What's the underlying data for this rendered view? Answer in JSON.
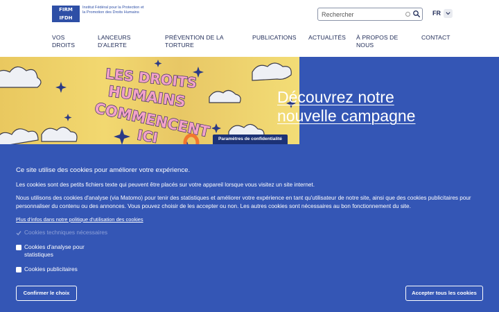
{
  "header": {
    "logo_mark_line1": "FIRM",
    "logo_mark_line2": "IFDH",
    "logo_text": "Institut Fédéral pour la Protection et la Promotion des Droits Humains",
    "search_placeholder": "Rechercher",
    "language": "FR"
  },
  "nav": [
    {
      "label": "Vos droits"
    },
    {
      "label": "Lanceurs d'alerte"
    },
    {
      "label": "Prévention de la torture"
    },
    {
      "label": "Publications"
    },
    {
      "label": "Actualités"
    },
    {
      "label": "À propos de nous"
    },
    {
      "label": "Contact"
    }
  ],
  "hero": {
    "image_text": "LES DROITS HUMAINS COMMENCENT ICI",
    "title": "Découvrez notre nouvelle campagne"
  },
  "cookie": {
    "tab": "Paramètres de confidentialité",
    "title": "Ce site utilise des cookies pour améliorer votre expérience.",
    "p1": "Les cookies sont des petits fichiers texte qui peuvent être placés sur votre appareil lorsque vous visitez un site internet.",
    "p2": "Nous utilisons des cookies d'analyse (via Matomo) pour tenir des statistiques et améliorer votre expérience en tant qu'utilisateur de notre site, ainsi que des cookies publicitaires pour personnaliser du contenu ou des annonces. Vous pouvez choisir de les accepter ou non. Les autres cookies sont nécessaires au bon fonctionnement du site.",
    "link": "Plus d'infos dans notre politique d'utilisation des cookies",
    "options": [
      {
        "label": "Cookies techniques nécessaires",
        "checked": true,
        "disabled": true
      },
      {
        "label": "Cookies d'analyse pour statistiques",
        "checked": false,
        "disabled": false
      },
      {
        "label": "Cookies publicitaires",
        "checked": false,
        "disabled": false
      }
    ],
    "confirm_label": "Confirmer le choix",
    "accept_all_label": "Accepter tous les cookies"
  },
  "colors": {
    "brand_blue": "#3456b5",
    "dark_blue": "#1c3276",
    "navy_text": "#1f2b57",
    "hero_yellow": "#f2d870",
    "pink": "#e64a8a",
    "orange": "#f2762e"
  }
}
